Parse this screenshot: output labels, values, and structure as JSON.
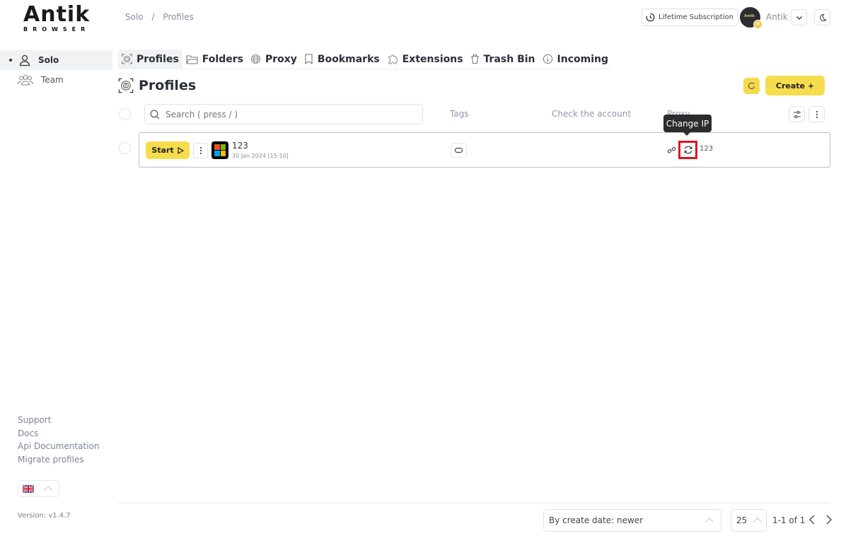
{
  "app": {
    "logo_main": "Antik",
    "logo_sub": "BROWSER"
  },
  "breadcrumb": [
    "Solo",
    "/",
    "Profiles"
  ],
  "header": {
    "subscription_label": "Lifetime Subscription",
    "user_name": "Antik",
    "avatar_text": "Antik"
  },
  "sidebar": {
    "items": [
      {
        "label": "Solo",
        "active": true
      },
      {
        "label": "Team",
        "active": false
      }
    ],
    "links": [
      "Support",
      "Docs",
      "Api Documentation",
      "Migrate profiles"
    ],
    "language": "EN",
    "version": "Version: v1.4.7"
  },
  "tabs": [
    {
      "label": "Profiles",
      "icon": "fingerprint-icon",
      "active": true
    },
    {
      "label": "Folders",
      "icon": "folder-icon"
    },
    {
      "label": "Proxy",
      "icon": "globe-icon"
    },
    {
      "label": "Bookmarks",
      "icon": "bookmark-icon"
    },
    {
      "label": "Extensions",
      "icon": "puzzle-icon"
    },
    {
      "label": "Trash Bin",
      "icon": "trash-icon"
    },
    {
      "label": "Incoming",
      "icon": "info-icon"
    }
  ],
  "page": {
    "title": "Profiles",
    "create_label": "Create +"
  },
  "table": {
    "search_placeholder": "Search ( press / )",
    "columns": [
      "Tags",
      "Check the account",
      "Proxy"
    ],
    "rows": [
      {
        "start_label": "Start",
        "name": "123",
        "date": "30 Jan 2024 [15:10]",
        "os": "windows",
        "proxy_name": "123"
      }
    ]
  },
  "tooltip": {
    "text": "Change IP"
  },
  "footer": {
    "sort_value": "By create date: newer",
    "per_page": "25",
    "page_info": "1-1 of 1"
  },
  "colors": {
    "accent": "#F7DD4D",
    "highlight": "#E0141E",
    "tooltip": "#2C2C2C"
  }
}
